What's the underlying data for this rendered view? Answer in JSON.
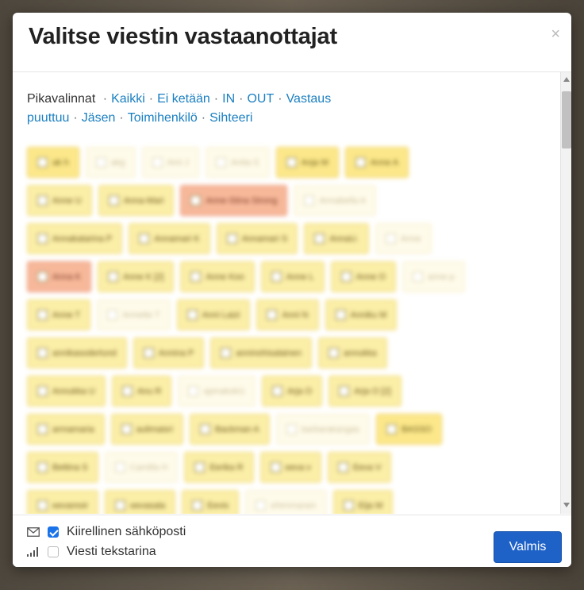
{
  "modal": {
    "title": "Valitse viestin vastaanottajat",
    "close_symbol": "×"
  },
  "quick": {
    "label": "Pikavalinnat",
    "separator": "·",
    "links": [
      "Kaikki",
      "Ei ketään",
      "IN",
      "OUT",
      "Vastaus puuttuu",
      "Jäsen",
      "Toimihenkilö",
      "Sihteeri"
    ]
  },
  "recipients": [
    [
      {
        "n": "ak h",
        "s": "bright"
      },
      {
        "n": "akg",
        "s": "faint"
      },
      {
        "n": "Ami J",
        "s": "faint"
      },
      {
        "n": "Anita S",
        "s": "faint"
      },
      {
        "n": "Anja M",
        "s": "bright"
      },
      {
        "n": "Anne A",
        "s": "bright"
      }
    ],
    [
      {
        "n": "Anne U",
        "s": "normal"
      },
      {
        "n": "Anna-Mari",
        "s": "normal"
      },
      {
        "n": "Anne-Stina Strong",
        "s": "orange"
      },
      {
        "n": "Annabella A",
        "s": "faint"
      }
    ],
    [
      {
        "n": "Annakatarina P",
        "s": "normal"
      },
      {
        "n": "Annamari K",
        "s": "normal"
      },
      {
        "n": "Annamari S",
        "s": "normal"
      },
      {
        "n": "AnnaU.",
        "s": "normal"
      },
      {
        "n": "Anne",
        "s": "faint"
      }
    ],
    [
      {
        "n": "Anna K",
        "s": "orange"
      },
      {
        "n": "Anne K [2]",
        "s": "normal"
      },
      {
        "n": "Anne Koo",
        "s": "normal"
      },
      {
        "n": "Anne L",
        "s": "normal"
      },
      {
        "n": "Anne O",
        "s": "normal"
      },
      {
        "n": "anne p",
        "s": "faint"
      }
    ],
    [
      {
        "n": "Anne T",
        "s": "normal"
      },
      {
        "n": "Annette T",
        "s": "faint"
      },
      {
        "n": "Anni Laizi",
        "s": "normal"
      },
      {
        "n": "Anni N",
        "s": "normal"
      },
      {
        "n": "Anniku M",
        "s": "normal"
      }
    ],
    [
      {
        "n": "annikasoderlund",
        "s": "normal"
      },
      {
        "n": "Annina P",
        "s": "normal"
      },
      {
        "n": "anninohisalainen",
        "s": "normal"
      },
      {
        "n": "annukka",
        "s": "normal"
      }
    ],
    [
      {
        "n": "Annukka U",
        "s": "normal"
      },
      {
        "n": "Anu R",
        "s": "normal"
      },
      {
        "n": "apinakoki1",
        "s": "faint"
      },
      {
        "n": "Arja O",
        "s": "normal"
      },
      {
        "n": "Arja O [2]",
        "s": "normal"
      }
    ],
    [
      {
        "n": "armamaria",
        "s": "normal"
      },
      {
        "n": "aulimaisri",
        "s": "normal"
      },
      {
        "n": "Backman A",
        "s": "normal"
      },
      {
        "n": "barbarakangas",
        "s": "faint"
      },
      {
        "n": "BASSO",
        "s": "bright"
      }
    ],
    [
      {
        "n": "Bettina S",
        "s": "normal"
      },
      {
        "n": "Camilla H",
        "s": "faint"
      },
      {
        "n": "Eerika R",
        "s": "normal"
      },
      {
        "n": "eeva v",
        "s": "normal"
      },
      {
        "n": "Eeva V",
        "s": "normal"
      }
    ],
    [
      {
        "n": "eevamoir",
        "s": "normal"
      },
      {
        "n": "eevasala",
        "s": "normal"
      },
      {
        "n": "Eevis",
        "s": "normal"
      },
      {
        "n": "ehimmanen",
        "s": "faint"
      },
      {
        "n": "Eija M",
        "s": "normal"
      }
    ]
  ],
  "footer": {
    "email_label": "Kiirellinen sähköposti",
    "email_checked": true,
    "sms_label": "Viesti tekstarina",
    "sms_checked": false,
    "email_icon": "envelope-icon",
    "sms_icon": "signal-icon",
    "done_label": "Valmis"
  },
  "colors": {
    "primary": "#1e62c8",
    "link": "#1a7fc1",
    "chip_fill": "#fbeea7",
    "chip_alert": "#f7b89a"
  }
}
